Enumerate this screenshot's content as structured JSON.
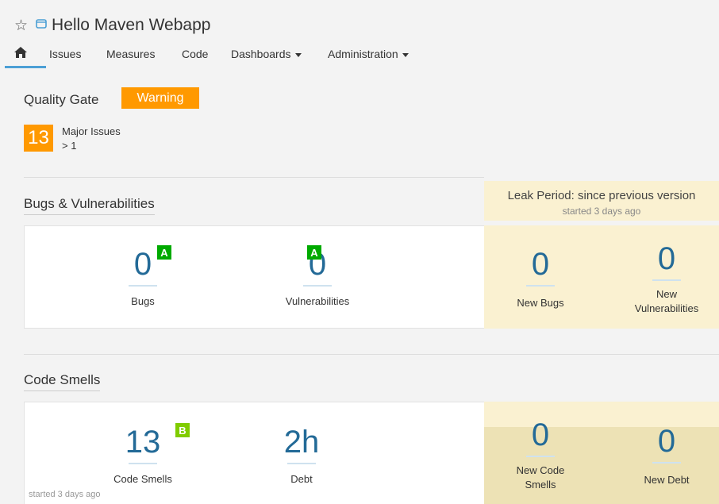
{
  "header": {
    "project_title": "Hello Maven Webapp",
    "nav": {
      "issues": "Issues",
      "measures": "Measures",
      "code": "Code",
      "dashboards": "Dashboards",
      "administration": "Administration"
    }
  },
  "quality_gate": {
    "label": "Quality Gate",
    "status": "Warning",
    "status_color": "#ff9900",
    "condition_value": "13",
    "condition_label": "Major Issues",
    "condition_threshold": "> 1"
  },
  "leak_period": {
    "title": "Leak Period: since previous version",
    "started": "started 3 days ago"
  },
  "bugs_vulnerabilities": {
    "title": "Bugs & Vulnerabilities",
    "bugs": {
      "value": "0",
      "rating": "A",
      "label": "Bugs"
    },
    "vulnerabilities": {
      "value": "0",
      "rating": "A",
      "label": "Vulnerabilities"
    },
    "new_bugs": {
      "value": "0",
      "label": "New Bugs"
    },
    "new_vulnerabilities": {
      "value": "0",
      "label_line1": "New",
      "label_line2": "Vulnerabilities"
    }
  },
  "code_smells": {
    "title": "Code Smells",
    "smells": {
      "value": "13",
      "rating": "B",
      "label": "Code Smells"
    },
    "debt": {
      "value": "2h",
      "label": "Debt"
    },
    "new_code_smells": {
      "value": "0",
      "label_line1": "New Code",
      "label_line2": "Smells"
    },
    "new_debt": {
      "value": "0",
      "label": "New Debt"
    },
    "started": "started 3 days ago"
  },
  "colors": {
    "accent": "#4b9fd5",
    "metric_value": "#236a97",
    "rating_a": "#00aa00",
    "rating_b": "#80cc00",
    "leak_background": "#faf1d1"
  }
}
